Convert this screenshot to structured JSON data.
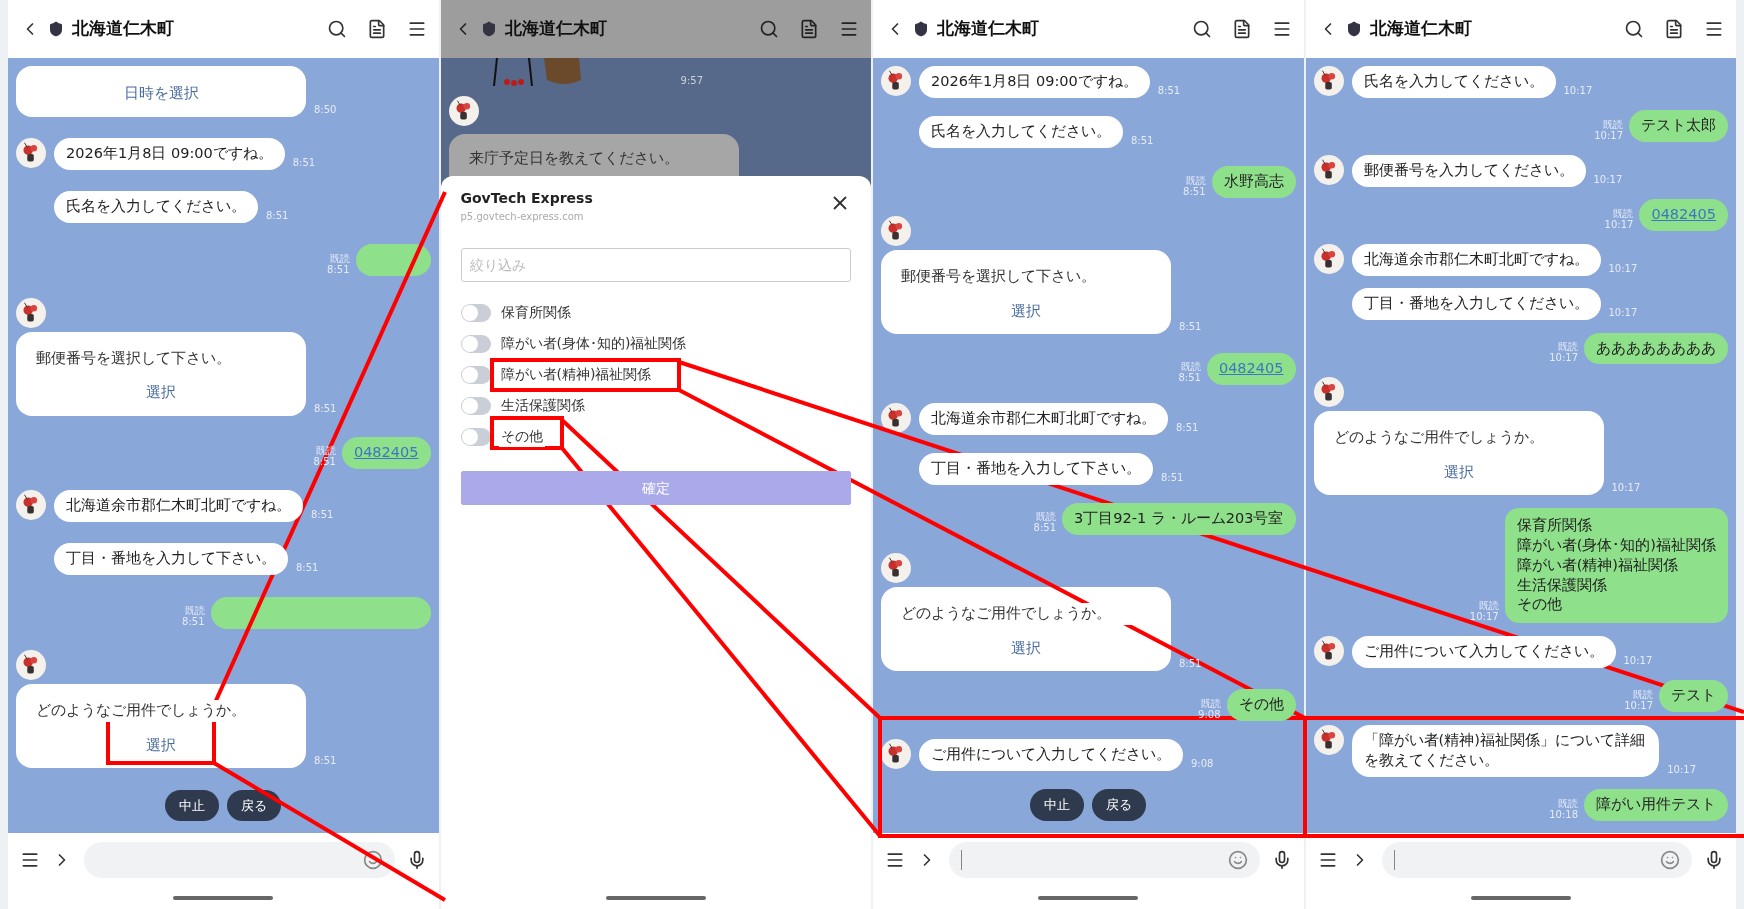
{
  "panels": [
    {
      "kind": "chat",
      "header": {
        "title": "北海道仁木町"
      },
      "messages": [
        {
          "kind": "card",
          "avatar": false,
          "button": "日時を選択",
          "time": "8:50"
        },
        {
          "kind": "bot",
          "avatar": true,
          "text": "2026年1月8日 09:00ですね。",
          "time": "8:51"
        },
        {
          "kind": "bot",
          "avatar": false,
          "text": "氏名を入力してください。",
          "time": "8:51"
        },
        {
          "kind": "redacted",
          "wide": false,
          "read": "既読",
          "time": "8:51"
        },
        {
          "kind": "card",
          "avatar": true,
          "text": "郵便番号を選択して下さい。",
          "button": "選択",
          "time": "8:51"
        },
        {
          "kind": "user",
          "link": true,
          "lines": [
            "0482405"
          ],
          "read": "既読",
          "time": "8:51"
        },
        {
          "kind": "bot",
          "avatar": true,
          "text": "北海道余市郡仁木町北町ですね。",
          "time": "8:51"
        },
        {
          "kind": "bot",
          "avatar": false,
          "text": "丁目・番地を入力して下さい。",
          "time": "8:51"
        },
        {
          "kind": "redacted",
          "wide": true,
          "read": "既読",
          "time": "8:51"
        },
        {
          "kind": "card",
          "avatar": true,
          "text": "どのようなご用件でしょうか。",
          "button": "選択",
          "time": "8:51"
        }
      ],
      "quick_replies": [
        "中止",
        "戻る"
      ],
      "input": {
        "cursor": false
      }
    },
    {
      "kind": "sheet",
      "header": {
        "title": "北海道仁木町"
      },
      "background": {
        "time": "9:57",
        "card_text": "来庁予定日を教えてください。"
      },
      "sheet": {
        "title": "GovTech Express",
        "url": "p5.govtech-express.com",
        "filter_placeholder": "絞り込み",
        "options": [
          {
            "label": "保育所関係",
            "on": false
          },
          {
            "label": "障がい者(身体･知的)福祉関係",
            "on": false
          },
          {
            "label": "障がい者(精神)福祉関係",
            "on": false
          },
          {
            "label": "生活保護関係",
            "on": false
          },
          {
            "label": "その他",
            "on": false
          }
        ],
        "confirm": {
          "label": "確定",
          "disabled": true
        }
      }
    },
    {
      "kind": "chat",
      "header": {
        "title": "北海道仁木町"
      },
      "messages": [
        {
          "kind": "bot",
          "avatar": true,
          "text": "2026年1月8日 09:00ですね。",
          "time": "8:51"
        },
        {
          "kind": "bot",
          "avatar": false,
          "text": "氏名を入力してください。",
          "time": "8:51"
        },
        {
          "kind": "user",
          "link": false,
          "lines": [
            "水野高志"
          ],
          "read": "既読",
          "time": "8:51"
        },
        {
          "kind": "card",
          "avatar": true,
          "text": "郵便番号を選択して下さい。",
          "button": "選択",
          "time": "8:51"
        },
        {
          "kind": "user",
          "link": true,
          "lines": [
            "0482405"
          ],
          "read": "既読",
          "time": "8:51"
        },
        {
          "kind": "bot",
          "avatar": true,
          "text": "北海道余市郡仁木町北町ですね。",
          "time": "8:51"
        },
        {
          "kind": "bot",
          "avatar": false,
          "text": "丁目・番地を入力して下さい。",
          "time": "8:51"
        },
        {
          "kind": "user",
          "link": false,
          "lines": [
            "3丁目92-1 ラ・ルーム203号室"
          ],
          "read": "既読",
          "time": "8:51"
        },
        {
          "kind": "card",
          "avatar": true,
          "text": "どのようなご用件でしょうか。",
          "button": "選択",
          "time": "8:51"
        },
        {
          "kind": "user",
          "link": false,
          "lines": [
            "その他"
          ],
          "read": "既読",
          "time": "9:08"
        },
        {
          "kind": "bot",
          "avatar": true,
          "text": "ご用件について入力してください。",
          "time": "9:08"
        }
      ],
      "quick_replies": [
        "中止",
        "戻る"
      ],
      "input": {
        "cursor": true
      }
    },
    {
      "kind": "chat",
      "header": {
        "title": "北海道仁木町"
      },
      "messages": [
        {
          "kind": "bot",
          "avatar": true,
          "text": "氏名を入力してください。",
          "time": "10:17"
        },
        {
          "kind": "user",
          "link": false,
          "lines": [
            "テスト太郎"
          ],
          "read": "既読",
          "time": "10:17"
        },
        {
          "kind": "bot",
          "avatar": true,
          "text": "郵便番号を入力してください。",
          "time": "10:17"
        },
        {
          "kind": "user",
          "link": true,
          "lines": [
            "0482405"
          ],
          "read": "既読",
          "time": "10:17"
        },
        {
          "kind": "bot",
          "avatar": true,
          "text": "北海道余市郡仁木町北町ですね。",
          "time": "10:17"
        },
        {
          "kind": "bot",
          "avatar": false,
          "text": "丁目・番地を入力してください。",
          "time": "10:17"
        },
        {
          "kind": "user",
          "link": false,
          "lines": [
            "ああああああああ"
          ],
          "read": "既読",
          "time": "10:17"
        },
        {
          "kind": "card",
          "avatar": true,
          "text": "どのようなご用件でしょうか。",
          "button": "選択",
          "time": "10:17"
        },
        {
          "kind": "user",
          "link": false,
          "lines": [
            "保育所関係",
            "障がい者(身体･知的)福祉関係",
            "障がい者(精神)福祉関係",
            "生活保護関係",
            "その他"
          ],
          "read": "既読",
          "time": "10:17"
        },
        {
          "kind": "bot",
          "avatar": true,
          "text": "ご用件について入力してください。",
          "time": "10:17"
        },
        {
          "kind": "user",
          "link": false,
          "lines": [
            "テスト"
          ],
          "read": "既読",
          "time": "10:17"
        },
        {
          "kind": "bot",
          "avatar": true,
          "text": "「障がい者(精神)福祉関係」について詳細を教えてください。",
          "time": "10:17"
        },
        {
          "kind": "user",
          "link": false,
          "lines": [
            "障がい用件テスト"
          ],
          "read": "既読",
          "time": "10:18"
        }
      ],
      "input": {
        "cursor": true
      }
    }
  ]
}
